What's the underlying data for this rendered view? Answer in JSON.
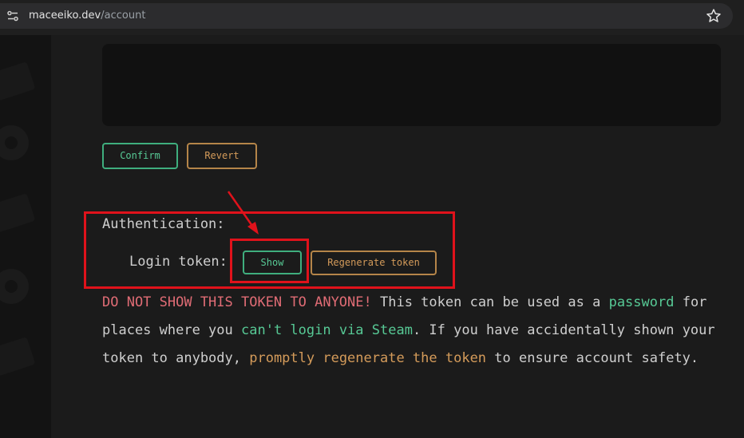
{
  "browser": {
    "url_domain": "maceeiko.dev",
    "url_path": "/account",
    "icons": [
      "site-settings-icon",
      "bookmark-star-icon"
    ]
  },
  "actions": {
    "confirm_label": "Confirm",
    "revert_label": "Revert"
  },
  "auth": {
    "heading": "Authentication:",
    "token_label": "Login token:",
    "show_label": "Show",
    "regenerate_label": "Regenerate token"
  },
  "warning": {
    "part1": "DO NOT SHOW THIS TOKEN TO ANYONE!",
    "part2": " This token can be used as a ",
    "part3": "password",
    "part4": " for places where you ",
    "part5": "can't login via Steam",
    "part6": ". If you have accidentally shown your token to anybody, ",
    "part7": "promptly regenerate the token",
    "part8": " to ensure account safety."
  },
  "colors": {
    "green": "#57c995",
    "orange": "#d49b5a",
    "red": "#e06c75",
    "highlight": "#e0121b"
  }
}
